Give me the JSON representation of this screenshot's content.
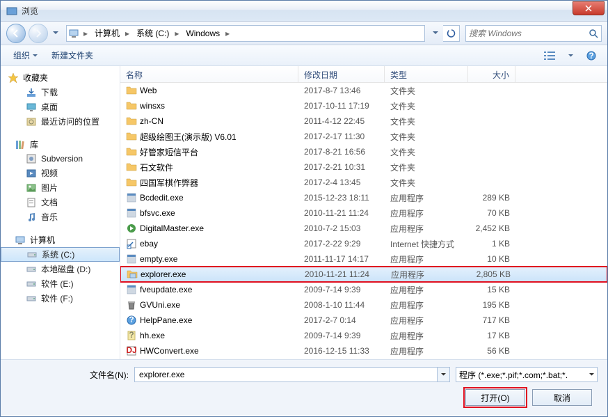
{
  "window": {
    "title": "浏览"
  },
  "nav": {
    "path": [
      {
        "icon": "computer",
        "label": "计算机"
      },
      {
        "label": "系统 (C:)"
      },
      {
        "label": "Windows"
      }
    ],
    "search_placeholder": "搜索 Windows"
  },
  "toolbar": {
    "organize": "组织",
    "newfolder": "新建文件夹"
  },
  "sidebar": {
    "favorites": {
      "label": "收藏夹",
      "items": [
        {
          "icon": "download",
          "label": "下载"
        },
        {
          "icon": "desktop",
          "label": "桌面"
        },
        {
          "icon": "recent",
          "label": "最近访问的位置"
        }
      ]
    },
    "libraries": {
      "label": "库",
      "items": [
        {
          "icon": "svn",
          "label": "Subversion"
        },
        {
          "icon": "video",
          "label": "视频"
        },
        {
          "icon": "picture",
          "label": "图片"
        },
        {
          "icon": "document",
          "label": "文档"
        },
        {
          "icon": "music",
          "label": "音乐"
        }
      ]
    },
    "computer": {
      "label": "计算机",
      "items": [
        {
          "icon": "drive",
          "label": "系统 (C:)",
          "selected": true
        },
        {
          "icon": "drive",
          "label": "本地磁盘 (D:)"
        },
        {
          "icon": "drive",
          "label": "软件 (E:)"
        },
        {
          "icon": "drive",
          "label": "软件 (F:)"
        }
      ]
    }
  },
  "columns": {
    "name": "名称",
    "date": "修改日期",
    "type": "类型",
    "size": "大小"
  },
  "files": [
    {
      "icon": "folder",
      "name": "Web",
      "date": "2017-8-7 13:46",
      "type": "文件夹",
      "size": ""
    },
    {
      "icon": "folder",
      "name": "winsxs",
      "date": "2017-10-11 17:19",
      "type": "文件夹",
      "size": ""
    },
    {
      "icon": "folder",
      "name": "zh-CN",
      "date": "2011-4-12 22:45",
      "type": "文件夹",
      "size": ""
    },
    {
      "icon": "folder",
      "name": "超级绘图王(演示版) V6.01",
      "date": "2017-2-17 11:30",
      "type": "文件夹",
      "size": ""
    },
    {
      "icon": "folder",
      "name": "好管家短信平台",
      "date": "2017-8-21 16:56",
      "type": "文件夹",
      "size": ""
    },
    {
      "icon": "folder",
      "name": "石文软件",
      "date": "2017-2-21 10:31",
      "type": "文件夹",
      "size": ""
    },
    {
      "icon": "folder",
      "name": "四国军棋作弊器",
      "date": "2017-2-4 13:45",
      "type": "文件夹",
      "size": ""
    },
    {
      "icon": "exe",
      "name": "Bcdedit.exe",
      "date": "2015-12-23 18:11",
      "type": "应用程序",
      "size": "289 KB"
    },
    {
      "icon": "exe",
      "name": "bfsvc.exe",
      "date": "2010-11-21 11:24",
      "type": "应用程序",
      "size": "70 KB"
    },
    {
      "icon": "exe-green",
      "name": "DigitalMaster.exe",
      "date": "2010-7-2 15:03",
      "type": "应用程序",
      "size": "2,452 KB"
    },
    {
      "icon": "shortcut",
      "name": "ebay",
      "date": "2017-2-22 9:29",
      "type": "Internet 快捷方式",
      "size": "1 KB"
    },
    {
      "icon": "exe",
      "name": "empty.exe",
      "date": "2011-11-17 14:17",
      "type": "应用程序",
      "size": "10 KB"
    },
    {
      "icon": "explorer",
      "name": "explorer.exe",
      "date": "2010-11-21 11:24",
      "type": "应用程序",
      "size": "2,805 KB",
      "selected": true,
      "highlighted": true
    },
    {
      "icon": "exe",
      "name": "fveupdate.exe",
      "date": "2009-7-14 9:39",
      "type": "应用程序",
      "size": "15 KB"
    },
    {
      "icon": "trash",
      "name": "GVUni.exe",
      "date": "2008-1-10 11:44",
      "type": "应用程序",
      "size": "195 KB"
    },
    {
      "icon": "help",
      "name": "HelpPane.exe",
      "date": "2017-2-7 0:14",
      "type": "应用程序",
      "size": "717 KB"
    },
    {
      "icon": "help2",
      "name": "hh.exe",
      "date": "2009-7-14 9:39",
      "type": "应用程序",
      "size": "17 KB"
    },
    {
      "icon": "dj",
      "name": "HWConvert.exe",
      "date": "2016-12-15 11:33",
      "type": "应用程序",
      "size": "56 KB"
    }
  ],
  "footer": {
    "filename_label": "文件名(N):",
    "filename_value": "explorer.exe",
    "filter_label": "程序 (*.exe;*.pif;*.com;*.bat;*.",
    "open": "打开(O)",
    "cancel": "取消"
  }
}
